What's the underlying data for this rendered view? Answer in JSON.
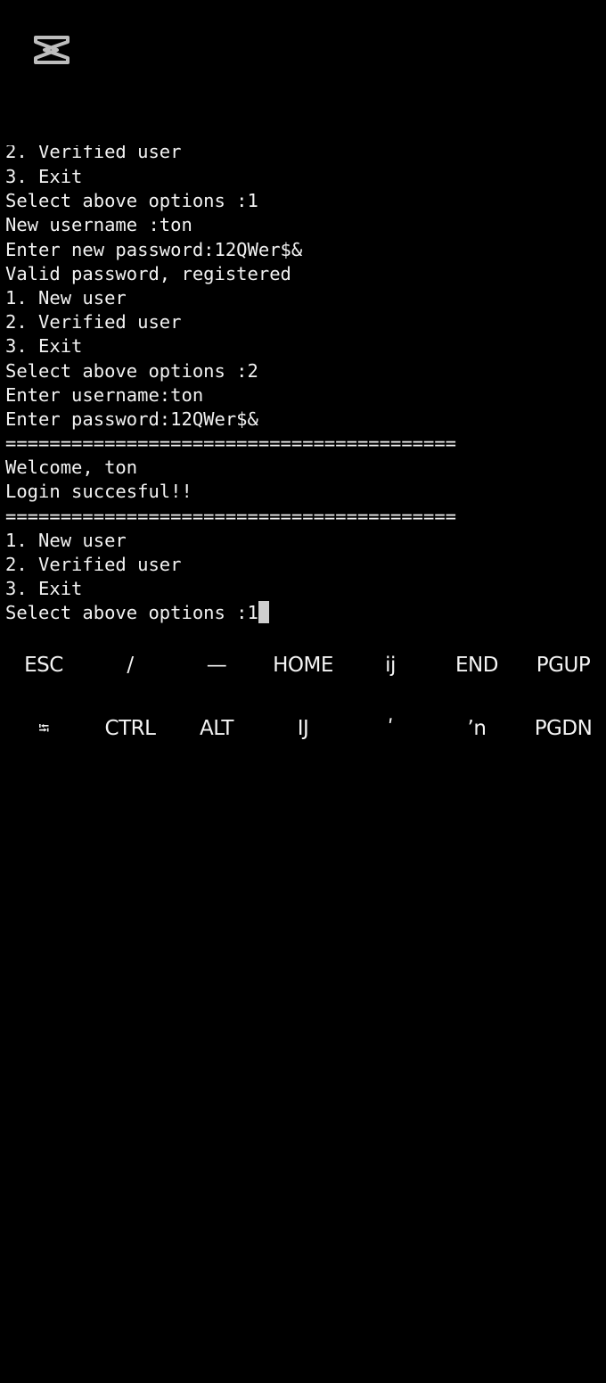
{
  "app": {
    "logo_icon": "capcut-logo-icon"
  },
  "terminal": {
    "lines": [
      "2. Verified user",
      "3. Exit",
      "Select above options :1",
      "New username :ton",
      "Enter new password:12QWer$&",
      "Valid password, registered",
      "1. New user",
      "2. Verified user",
      "3. Exit",
      "Select above options :2",
      "Enter username:ton",
      "Enter password:12QWer$&",
      "=========================================",
      "Welcome, ton",
      "Login succesful!!",
      "=========================================",
      "1. New user",
      "2. Verified user",
      "3. Exit",
      "Select above options :1"
    ]
  },
  "extra_keys": {
    "row1": [
      "ESC",
      "/",
      "—",
      "HOME",
      "ij",
      "END",
      "PGUP"
    ],
    "row2": [
      "⭾",
      "CTRL",
      "ALT",
      "IJ",
      "ʹ",
      "ʼn",
      "PGDN"
    ]
  },
  "colors": {
    "background": "#000000",
    "text": "#f2f2f2",
    "cursor": "#cfcfcf"
  }
}
